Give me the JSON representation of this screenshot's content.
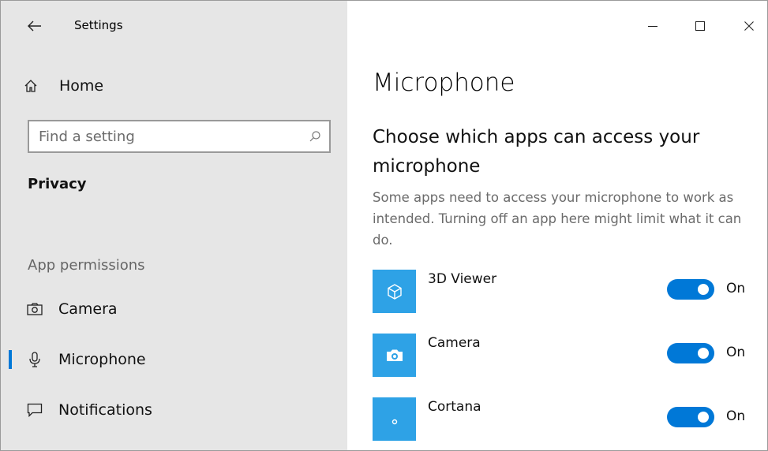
{
  "window": {
    "title": "Settings",
    "controls": {
      "minimize": "—",
      "maximize": "□",
      "close": "✕"
    }
  },
  "sidebar": {
    "home_label": "Home",
    "search_placeholder": "Find a setting",
    "section_title": "Privacy",
    "group_header": "App permissions",
    "items": [
      {
        "label": "Camera",
        "icon": "camera-icon",
        "selected": false
      },
      {
        "label": "Microphone",
        "icon": "microphone-icon",
        "selected": true
      },
      {
        "label": "Notifications",
        "icon": "notifications-icon",
        "selected": false
      }
    ]
  },
  "main": {
    "page_title": "Microphone",
    "subheading": "Choose which apps can access your microphone",
    "description": "Some apps need to access your microphone to work as intended. Turning off an app here might limit what it can do.",
    "apps": [
      {
        "name": "3D Viewer",
        "icon": "cube-icon",
        "state": "On",
        "enabled": true
      },
      {
        "name": "Camera",
        "icon": "camera-app-icon",
        "state": "On",
        "enabled": true
      },
      {
        "name": "Cortana",
        "icon": "cortana-icon",
        "state": "On",
        "enabled": true
      }
    ]
  },
  "colors": {
    "accent": "#0078d7",
    "app_tile": "#2ea2e6",
    "sidebar_bg": "#e6e6e6"
  }
}
